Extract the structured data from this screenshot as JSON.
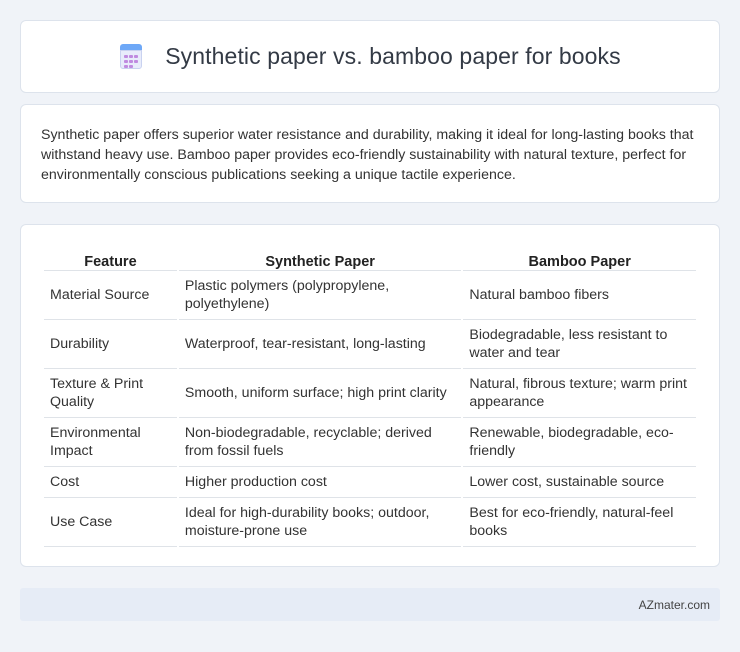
{
  "header": {
    "title": "Synthetic paper vs. bamboo paper for books",
    "icon": "calendar-icon"
  },
  "summary": "Synthetic paper offers superior water resistance and durability, making it ideal for long-lasting books that withstand heavy use. Bamboo paper provides eco-friendly sustainability with natural texture, perfect for environmentally conscious publications seeking a unique tactile experience.",
  "table": {
    "headers": [
      "Feature",
      "Synthetic Paper",
      "Bamboo Paper"
    ],
    "rows": [
      [
        "Material Source",
        "Plastic polymers (polypropylene, polyethylene)",
        "Natural bamboo fibers"
      ],
      [
        "Durability",
        "Waterproof, tear-resistant, long-lasting",
        "Biodegradable, less resistant to water and tear"
      ],
      [
        "Texture & Print Quality",
        "Smooth, uniform surface; high print clarity",
        "Natural, fibrous texture; warm print appearance"
      ],
      [
        "Environmental Impact",
        "Non-biodegradable, recyclable; derived from fossil fuels",
        "Renewable, biodegradable, eco-friendly"
      ],
      [
        "Cost",
        "Higher production cost",
        "Lower cost, sustainable source"
      ],
      [
        "Use Case",
        "Ideal for high-durability books; outdoor, moisture-prone use",
        "Best for eco-friendly, natural-feel books"
      ]
    ]
  },
  "footer": {
    "brand": "AZmater.com"
  }
}
